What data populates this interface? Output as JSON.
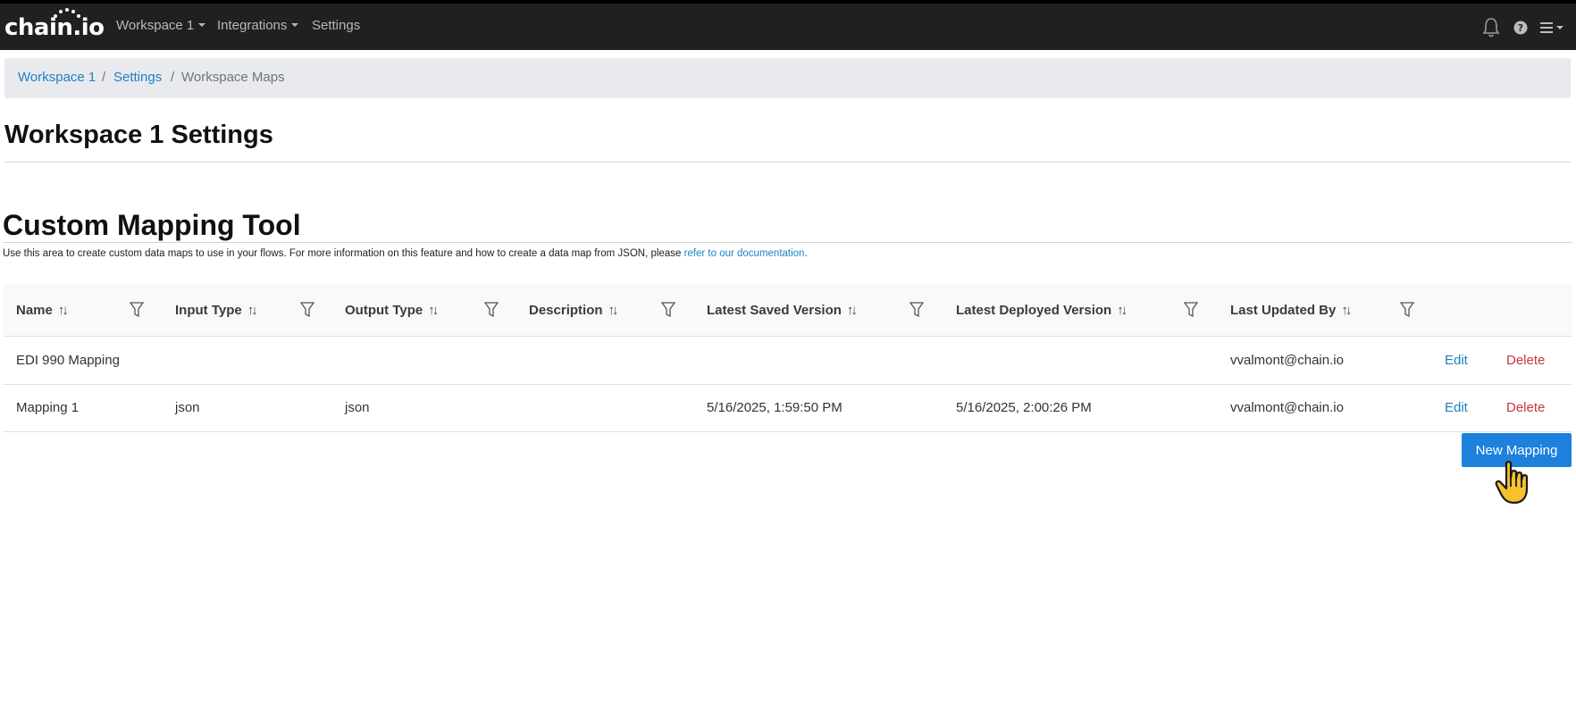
{
  "topbar": {
    "logo_text": "chain.io",
    "nav": [
      {
        "label": "Workspace 1"
      },
      {
        "label": "Integrations"
      },
      {
        "label": "Settings"
      }
    ],
    "icons": [
      "bell-icon",
      "help-icon",
      "menu-icon"
    ]
  },
  "breadcrumb": {
    "items": [
      {
        "label": "Workspace 1"
      },
      {
        "label": "Settings"
      },
      {
        "label": "Workspace Maps"
      }
    ],
    "separator": "/"
  },
  "page": {
    "title": "Workspace 1 Settings",
    "section_title": "Custom Mapping Tool",
    "description": "Use this area to create custom data maps to use in your flows. For more information on this feature and how to create a data map from JSON, please ",
    "description_link": "refer to our documentation",
    "description_end": "."
  },
  "table": {
    "columns": [
      {
        "label": "Name"
      },
      {
        "label": "Input Type"
      },
      {
        "label": "Output Type"
      },
      {
        "label": "Description"
      },
      {
        "label": "Latest Saved Version"
      },
      {
        "label": "Latest Deployed Version"
      },
      {
        "label": "Last Updated By"
      }
    ],
    "rows": [
      {
        "name": "EDI 990 Mapping",
        "input_type": "",
        "output_type": "",
        "description": "",
        "saved": "",
        "deployed": "",
        "updated_by": "vvalmont@chain.io",
        "edit": "Edit",
        "delete": "Delete"
      },
      {
        "name": "Mapping 1",
        "input_type": "json",
        "output_type": "json",
        "description": "",
        "saved": "5/16/2025, 1:59:50 PM",
        "deployed": "5/16/2025, 2:00:26 PM",
        "updated_by": "vvalmont@chain.io",
        "edit": "Edit",
        "delete": "Delete"
      }
    ]
  },
  "actions": {
    "new_mapping": "New Mapping"
  },
  "colors": {
    "topbar": "#202020",
    "link": "#1d81c5",
    "danger": "#c8363f",
    "primary": "#1d81dd"
  }
}
